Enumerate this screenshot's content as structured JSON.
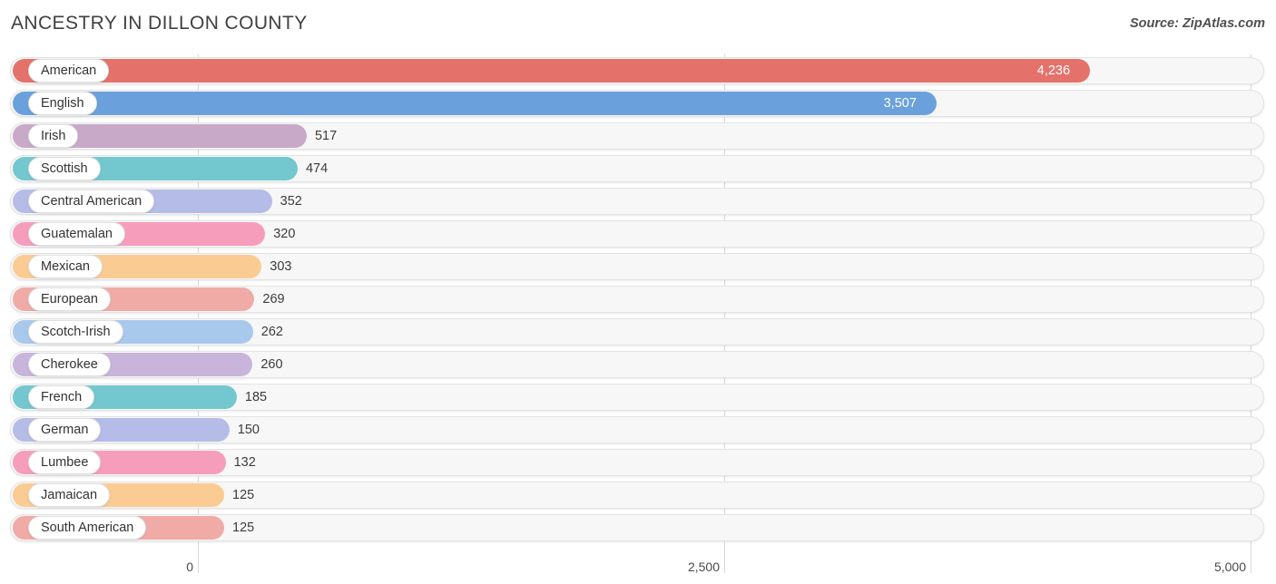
{
  "header": {
    "title": "ANCESTRY IN DILLON COUNTY",
    "source": "Source: ZipAtlas.com"
  },
  "chart_data": {
    "type": "bar",
    "orientation": "horizontal",
    "title": "ANCESTRY IN DILLON COUNTY",
    "xlabel": "",
    "ylabel": "",
    "xlim": [
      0,
      5000
    ],
    "grid": true,
    "legend": false,
    "xticks": [
      "0",
      "2,500",
      "5,000"
    ],
    "xtick_values": [
      0,
      2500,
      5000
    ],
    "categories": [
      "American",
      "English",
      "Irish",
      "Scottish",
      "Central American",
      "Guatemalan",
      "Mexican",
      "European",
      "Scotch-Irish",
      "Cherokee",
      "French",
      "German",
      "Lumbee",
      "Jamaican",
      "South American"
    ],
    "values": [
      4236,
      3507,
      517,
      474,
      352,
      320,
      303,
      269,
      262,
      260,
      185,
      150,
      132,
      125,
      125
    ],
    "value_labels": [
      "4,236",
      "3,507",
      "517",
      "474",
      "352",
      "320",
      "303",
      "269",
      "262",
      "260",
      "185",
      "150",
      "132",
      "125",
      "125"
    ],
    "bar_colors": [
      "#e4726b",
      "#6aa1dc",
      "#c8aac8",
      "#72c8ce",
      "#b5bce8",
      "#f79dbc",
      "#fbcb94",
      "#f0aba6",
      "#a8c8ec",
      "#c9b4dc",
      "#72c8ce",
      "#b5bce8",
      "#f79dbc",
      "#fbcb94",
      "#f0aba6"
    ],
    "label_inside_bar": [
      true,
      true,
      false,
      false,
      false,
      false,
      false,
      false,
      false,
      false,
      false,
      false,
      false,
      false,
      false
    ]
  }
}
